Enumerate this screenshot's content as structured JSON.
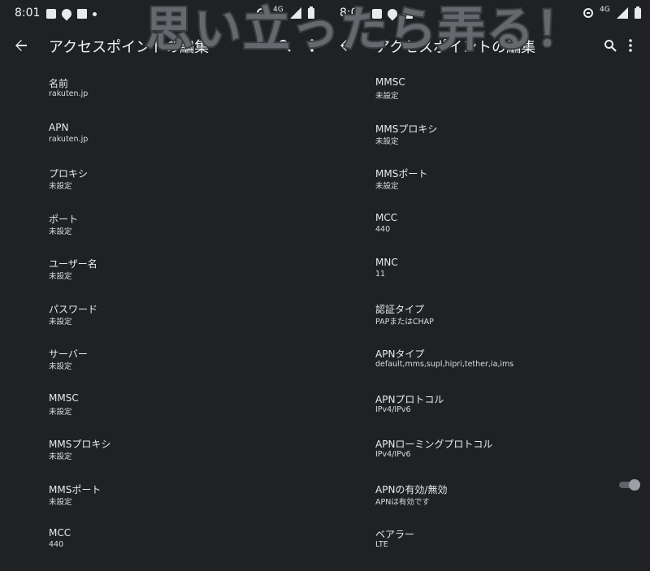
{
  "status": {
    "time": "8:01",
    "network": "4G"
  },
  "header": {
    "title": "アクセスポイントの編集"
  },
  "left_items": [
    {
      "label": "名前",
      "value": "rakuten.jp"
    },
    {
      "label": "APN",
      "value": "rakuten.jp"
    },
    {
      "label": "プロキシ",
      "value": "未設定"
    },
    {
      "label": "ポート",
      "value": "未設定"
    },
    {
      "label": "ユーザー名",
      "value": "未設定"
    },
    {
      "label": "パスワード",
      "value": "未設定"
    },
    {
      "label": "サーバー",
      "value": "未設定"
    },
    {
      "label": "MMSC",
      "value": "未設定"
    },
    {
      "label": "MMSプロキシ",
      "value": "未設定"
    },
    {
      "label": "MMSポート",
      "value": "未設定"
    },
    {
      "label": "MCC",
      "value": "440"
    }
  ],
  "right_items": [
    {
      "label": "MMSC",
      "value": "未設定"
    },
    {
      "label": "MMSプロキシ",
      "value": "未設定"
    },
    {
      "label": "MMSポート",
      "value": "未設定"
    },
    {
      "label": "MCC",
      "value": "440"
    },
    {
      "label": "MNC",
      "value": "11"
    },
    {
      "label": "認証タイプ",
      "value": "PAPまたはCHAP"
    },
    {
      "label": "APNタイプ",
      "value": "default,mms,supl,hipri,tether,ia,ims"
    },
    {
      "label": "APNプロトコル",
      "value": "IPv4/IPv6"
    },
    {
      "label": "APNローミングプロトコル",
      "value": "IPv4/IPv6"
    },
    {
      "label": "APNの有効/無効",
      "value": "APNは有効です"
    },
    {
      "label": "ベアラー",
      "value": "LTE"
    }
  ],
  "apn_enabled": true,
  "watermark": "思い立ったら弄る！",
  "colors": {
    "background": "#202124",
    "text": "#e8eaed"
  }
}
